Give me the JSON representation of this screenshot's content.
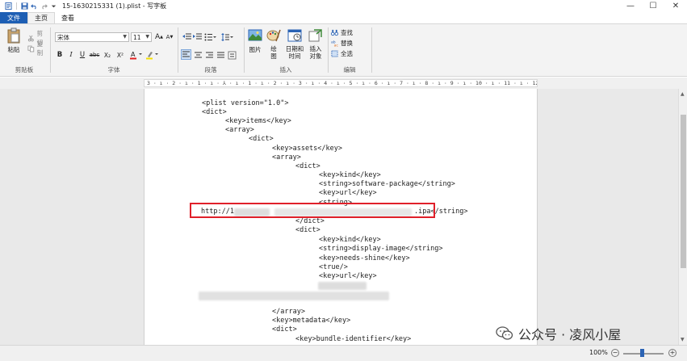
{
  "window": {
    "title": "15-1630215331 (1).plist - 写字板"
  },
  "tabs": {
    "file": "文件",
    "home": "主页",
    "view": "查看"
  },
  "clipboard": {
    "paste": "粘贴",
    "cut": "剪切",
    "copy": "复制",
    "group_label": "剪贴板"
  },
  "font": {
    "family": "宋体",
    "size": "11",
    "group_label": "字体",
    "bold": "B",
    "italic": "I",
    "underline": "U",
    "strikethrough": "abc",
    "subscript": "X₂",
    "superscript": "X²",
    "grow": "A",
    "shrink": "A"
  },
  "paragraph": {
    "group_label": "段落"
  },
  "insert": {
    "picture": "图片",
    "paint": "绘\n图",
    "datetime": "日期和\n时间",
    "object": "插入\n对象",
    "group_label": "插入"
  },
  "edit": {
    "find": "查找",
    "replace": "替换",
    "select_all": "全选",
    "group_label": "编辑"
  },
  "ruler": {
    "text": "3 · ı · 2 · ı · 1 · ı · ⅄ · ı · 1 · ı · 2 · ı · 3 · ı · 4 · ı · 5 · ı · 6 · ı · 7 · ı · 8 · ı · 9 · ı · 10 · ı · 11 · ı · 12 · ı · 13 · ı · 14 · ı · 15 · ı · 16 · ı · 17 · ı · 18"
  },
  "document": {
    "lines": [
      "<plist version=\"1.0\">",
      "<dict>",
      "<key>items</key>",
      "<array>",
      "<dict>",
      "<key>assets</key>",
      "<array>",
      "<dict>",
      "<key>kind</key>",
      "<string>software-package</string>",
      "<key>url</key>",
      "<string>",
      "http://1",
      ".ipa</string>",
      "</dict>",
      "<dict>",
      "<key>kind</key>",
      "<string>display-image</string>",
      "<key>needs-shine</key>",
      "<true/>",
      "<key>url</key>",
      "</array>",
      "<key>metadata</key>",
      "<dict>",
      "<key>bundle-identifier</key>"
    ]
  },
  "status": {
    "zoom": "100%"
  },
  "watermark": {
    "text": "公众号 · 凌风小屋"
  },
  "colors": {
    "file_tab": "#1e5fb4",
    "highlight_box": "#e0202a"
  }
}
